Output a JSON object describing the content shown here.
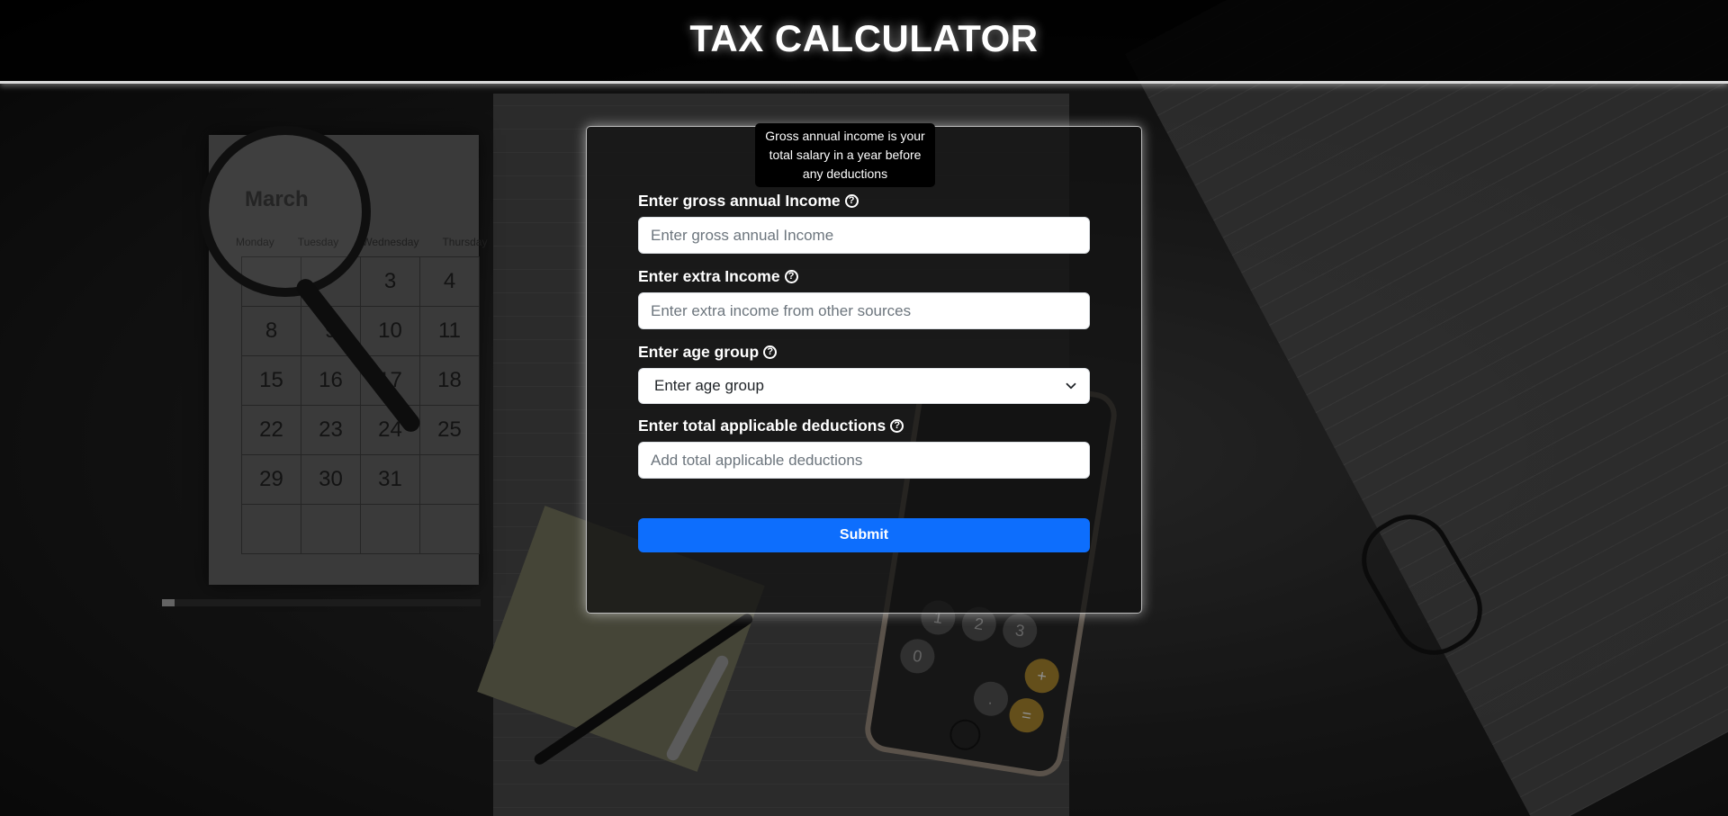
{
  "header": {
    "title": "TAX CALCULATOR"
  },
  "tooltip": {
    "text": "Gross annual income is your total salary in a year before any deductions"
  },
  "form": {
    "gross_income": {
      "label": "Enter gross annual Income",
      "placeholder": "Enter gross annual Income",
      "value": ""
    },
    "extra_income": {
      "label": "Enter extra Income",
      "placeholder": "Enter extra income from other sources",
      "value": ""
    },
    "age_group": {
      "label": "Enter age group",
      "selected": "Enter age group"
    },
    "deductions": {
      "label": "Enter total applicable deductions",
      "placeholder": "Add total applicable deductions",
      "value": ""
    },
    "submit_label": "Submit",
    "help_icon_glyph": "?"
  },
  "colors": {
    "accent": "#0d6efd",
    "header_bg": "#000000",
    "tooltip_bg": "#000000"
  },
  "background": {
    "calendar_month": "March",
    "calendar_weekdays": [
      "Monday",
      "Tuesday",
      "Wednesday",
      "Thursday"
    ],
    "calendar_dates": [
      "",
      "",
      "3",
      "4",
      "8",
      "9",
      "10",
      "11",
      "15",
      "16",
      "17",
      "18",
      "22",
      "23",
      "24",
      "25",
      "29",
      "30",
      "31",
      "",
      "",
      "",
      "",
      ""
    ],
    "phone_keys": [
      "1",
      "2",
      "3",
      "+",
      "0",
      ".",
      "="
    ]
  }
}
